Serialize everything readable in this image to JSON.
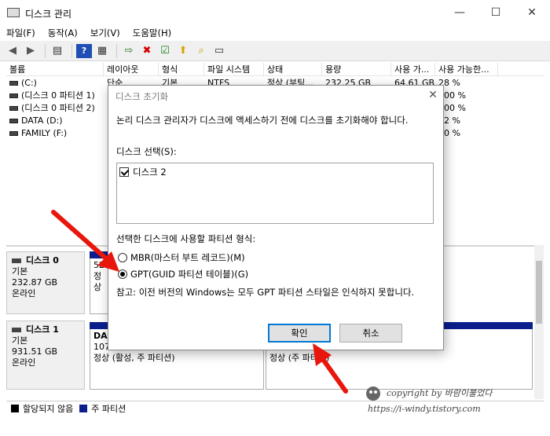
{
  "window": {
    "title": "디스크 관리",
    "minimize": "—",
    "maximize": "☐",
    "close": "✕"
  },
  "menu": [
    "파일(F)",
    "동작(A)",
    "보기(V)",
    "도움말(H)"
  ],
  "volume_table": {
    "headers": [
      "볼륨",
      "레이아웃",
      "형식",
      "파일 시스템",
      "상태",
      "용량",
      "사용 가...",
      "사용 가능한..."
    ],
    "rows": [
      {
        "volume": "(C:)",
        "layout": "단순",
        "type": "기본",
        "fs": "NTFS",
        "status": "정상 (부팅...",
        "capacity": "232.25 GB",
        "free": "64.61 GB",
        "pct": "28 %"
      },
      {
        "volume": "(디스크 0 파티션 1)",
        "layout": "단",
        "type": "",
        "fs": "",
        "status": "",
        "capacity": "",
        "free": "",
        "pct": "100 %"
      },
      {
        "volume": "(디스크 0 파티션 2)",
        "layout": "단",
        "type": "",
        "fs": "",
        "status": "",
        "capacity": "",
        "free": "",
        "pct": "100 %"
      },
      {
        "volume": "DATA (D:)",
        "layout": "단",
        "type": "",
        "fs": "",
        "status": "",
        "capacity": "",
        "free": "",
        "pct": "82 %"
      },
      {
        "volume": "FAMILY (F:)",
        "layout": "단",
        "type": "",
        "fs": "",
        "status": "",
        "capacity": "",
        "free": "",
        "pct": "50 %"
      }
    ]
  },
  "disks": [
    {
      "name": "디스크 0",
      "type": "기본",
      "size": "232.87 GB",
      "state": "온라인",
      "part_size": "529",
      "part_state": "정상"
    },
    {
      "name": "디스크 1",
      "type": "기본",
      "size": "931.51 GB",
      "state": "온라인",
      "p1_name": "DA",
      "p1_size": "107.42 GB NTFS",
      "p1_state": "정상 (활성, 주 파티션)",
      "p2_size": "824.09 GB NTFS",
      "p2_state": "정상 (주 파티션)"
    }
  ],
  "legend": {
    "unallocated": "할당되지 않음",
    "primary": "주 파티션"
  },
  "dialog": {
    "title": "디스크 초기화",
    "close": "✕",
    "description": "논리 디스크 관리자가 디스크에 액세스하기 전에 디스크를 초기화해야 합니다.",
    "select_label": "디스크 선택(S):",
    "disk_item": "디스크 2",
    "partition_label": "선택한 디스크에 사용할 파티션 형식:",
    "mbr": "MBR(마스터 부트 레코드)(M)",
    "gpt": "GPT(GUID 파티션 테이블)(G)",
    "note": "참고: 이전 버전의 Windows는 모두 GPT 파티션 스타일은 인식하지 못합니다.",
    "ok": "확인",
    "cancel": "취소"
  },
  "watermark": {
    "line1": "copyright by 바람이불었다",
    "line2": "https://i-windy.tistory.com"
  },
  "colors": {
    "primary_partition": "#0b1e8c",
    "arrow": "#e8160c",
    "focus": "#0078d7"
  }
}
